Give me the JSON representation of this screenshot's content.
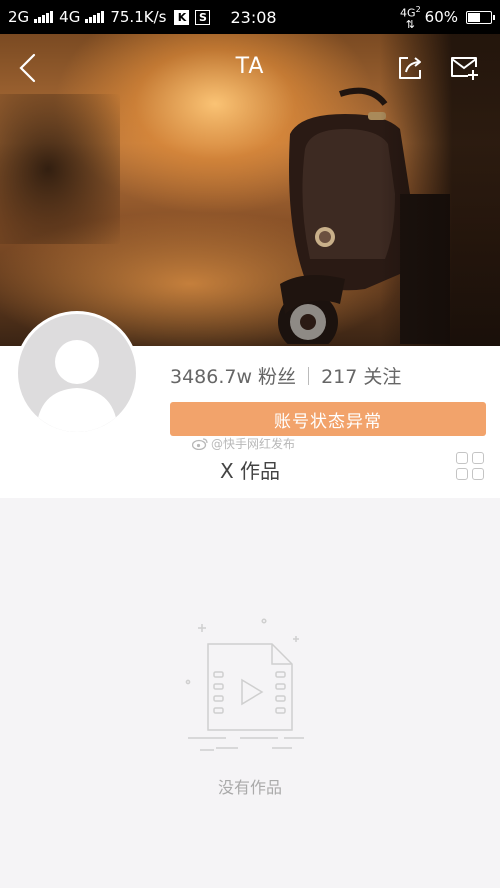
{
  "status_bar": {
    "net1": "2G",
    "net2": "4G",
    "speed": "75.1K/s",
    "icon_k": "K",
    "icon_s": "S",
    "time": "23:08",
    "net_right": "4G",
    "net_right_sub": "2",
    "battery": "60%",
    "battery_level": 0.6
  },
  "header": {
    "title": "TA"
  },
  "profile": {
    "followers": "3486.7w 粉丝",
    "following": "217 关注",
    "status_button": "账号状态异常",
    "watermark": "@快手网红发布"
  },
  "works": {
    "title": "X 作品",
    "empty_text": "没有作品"
  },
  "colors": {
    "accent": "#f2a36b",
    "background": "#f5f4f6"
  },
  "icons": [
    "back-icon",
    "share-icon",
    "message-icon",
    "grid-icon",
    "weibo-icon",
    "video-file-icon"
  ]
}
